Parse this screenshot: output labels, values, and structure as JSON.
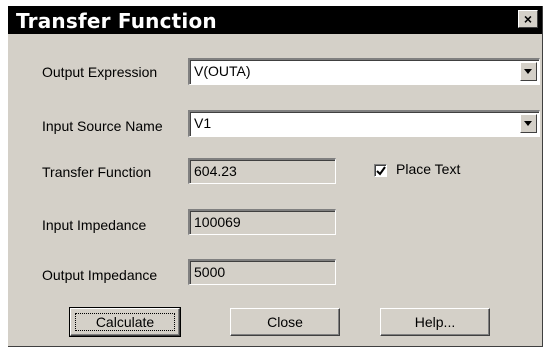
{
  "title": "Transfer Function",
  "close_symbol": "×",
  "output_expression": {
    "label": "Output Expression",
    "value": "V(OUTA)"
  },
  "input_source": {
    "label": "Input Source Name",
    "value": "V1"
  },
  "transfer_function": {
    "label": "Transfer Function",
    "value": "604.23"
  },
  "input_impedance": {
    "label": "Input Impedance",
    "value": "100069"
  },
  "output_impedance": {
    "label": "Output Impedance",
    "value": "5000"
  },
  "place_text": {
    "label": "Place Text",
    "checked": true
  },
  "buttons": {
    "calculate": "Calculate",
    "close": "Close",
    "help": "Help..."
  },
  "icons": [
    "close-icon",
    "dropdown-arrow-icon",
    "checkmark-icon"
  ]
}
